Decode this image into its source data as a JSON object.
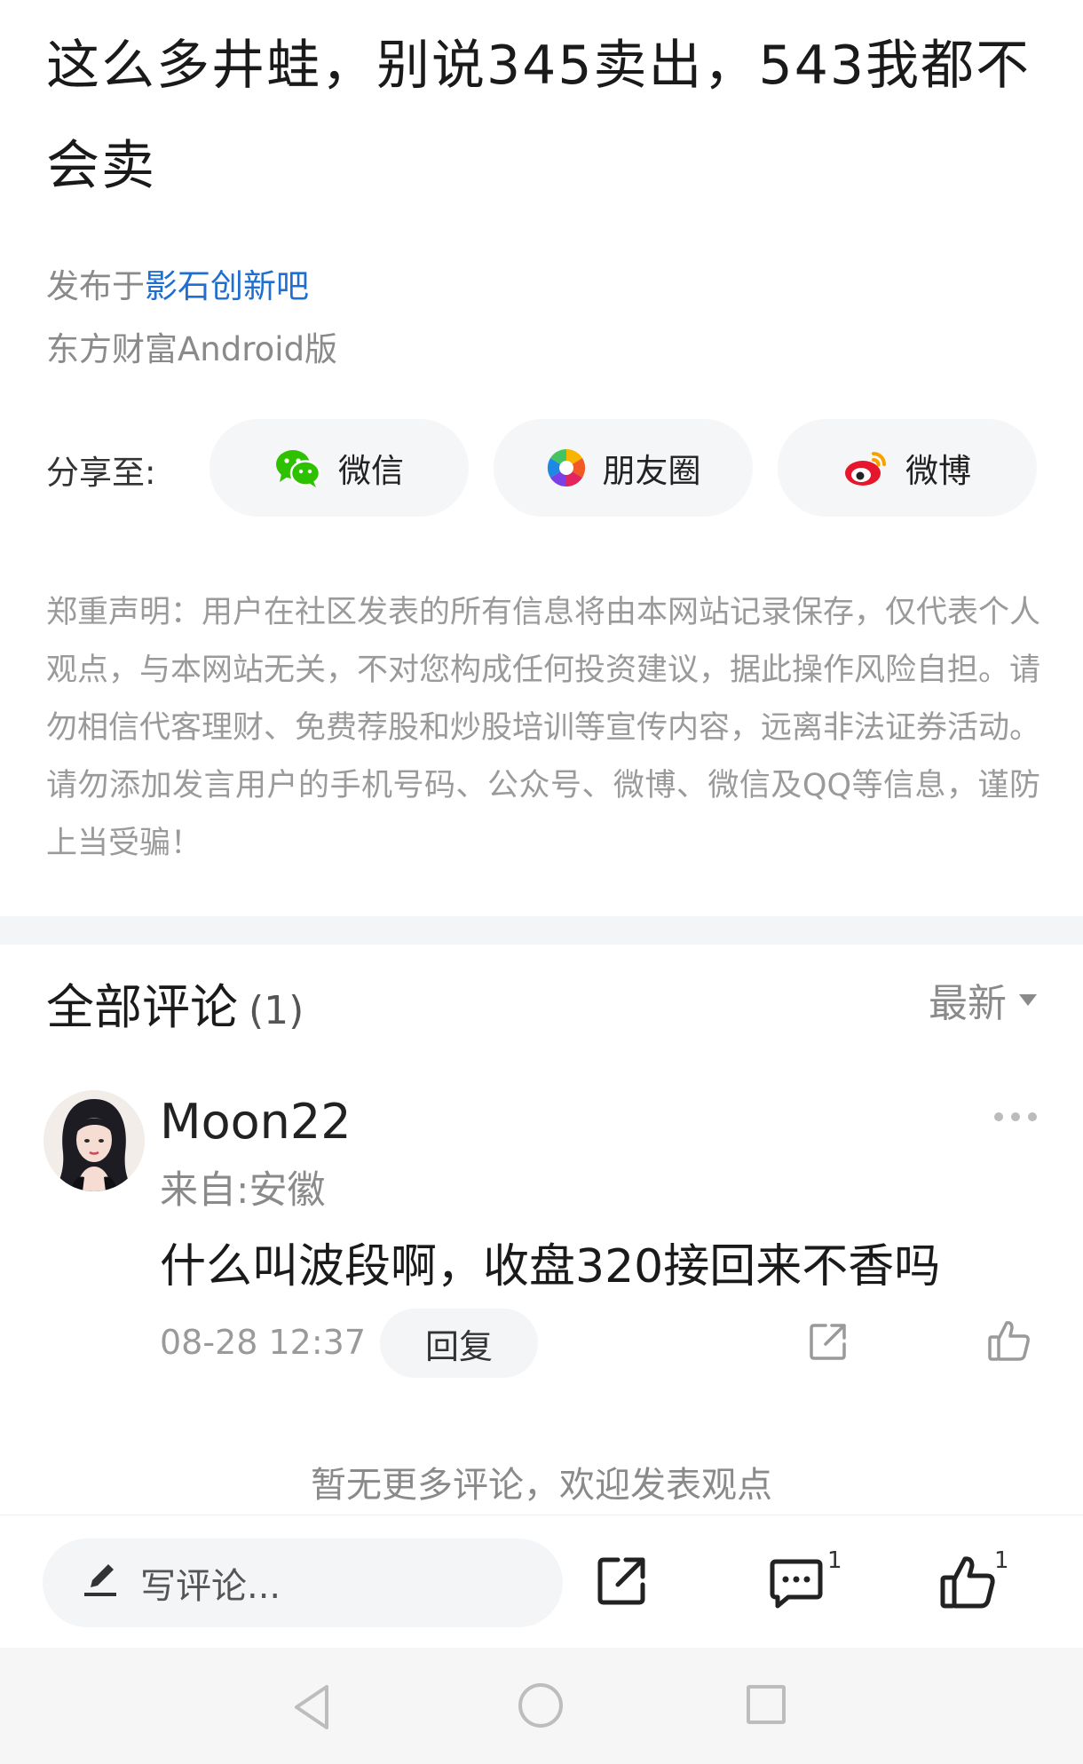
{
  "post": {
    "title": "这么多井蛙，别说345卖出，543我都不会卖",
    "published_prefix": "发布于",
    "forum_name": "影石创新吧",
    "source": "东方财富Android版"
  },
  "share": {
    "label": "分享至:",
    "wechat": "微信",
    "moments": "朋友圈",
    "weibo": "微博"
  },
  "disclaimer": "郑重声明：用户在社区发表的所有信息将由本网站记录保存，仅代表个人观点，与本网站无关，不对您构成任何投资建议，据此操作风险自担。请勿相信代客理财、免费荐股和炒股培训等宣传内容，远离非法证券活动。请勿添加发言用户的手机号码、公众号、微博、微信及QQ等信息，谨防上当受骗！",
  "comments": {
    "heading": "全部评论",
    "count": "(1)",
    "sort": "最新",
    "items": [
      {
        "username": "Moon22",
        "location": "来自:安徽",
        "text": "什么叫波段啊，收盘320接回来不香吗",
        "time": "08-28 12:37",
        "reply": "回复"
      }
    ],
    "no_more": "暂无更多评论，欢迎发表观点"
  },
  "bottom_bar": {
    "input_placeholder": "写评论...",
    "comment_count": "1",
    "like_count": "1"
  },
  "icons": {
    "wechat": "wechat-icon",
    "moments": "moments-icon",
    "weibo": "weibo-icon",
    "share": "share-icon",
    "like": "thumbs-up-icon",
    "comment": "comment-icon",
    "edit": "pencil-icon"
  },
  "colors": {
    "link": "#1f6fd1",
    "muted": "#8a8a8a",
    "wechat_green": "#2dc100",
    "weibo_red": "#e6162d"
  }
}
